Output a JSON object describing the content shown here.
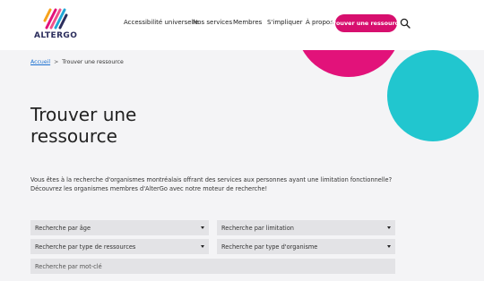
{
  "brand": {
    "name": "ALTERGO"
  },
  "nav": {
    "items": [
      "Accessibilité universelle",
      "Nos services",
      "Membres",
      "S'impliquer",
      "À propos"
    ],
    "cta": "Trouver une ressource"
  },
  "breadcrumb": {
    "home": "Accueil",
    "separator": ">",
    "current": "Trouver une ressource"
  },
  "page": {
    "title": "Trouver une ressource",
    "intro": "Vous êtes à la recherche d'organismes montréalais offrant des services aux personnes ayant une limitation fonctionnelle? Découvrez les organismes membres d'AlterGo avec notre moteur de recherche!"
  },
  "filters": {
    "age": "Recherche par âge",
    "limitation": "Recherche par limitation",
    "resource_type": "Recherche par type de ressources",
    "org_type": "Recherche par type d'organisme",
    "keyword_placeholder": "Recherche par mot-clé"
  },
  "colors": {
    "accent": "#d70f6e",
    "deco_pink": "#e2127a",
    "deco_teal": "#21c6cf"
  }
}
